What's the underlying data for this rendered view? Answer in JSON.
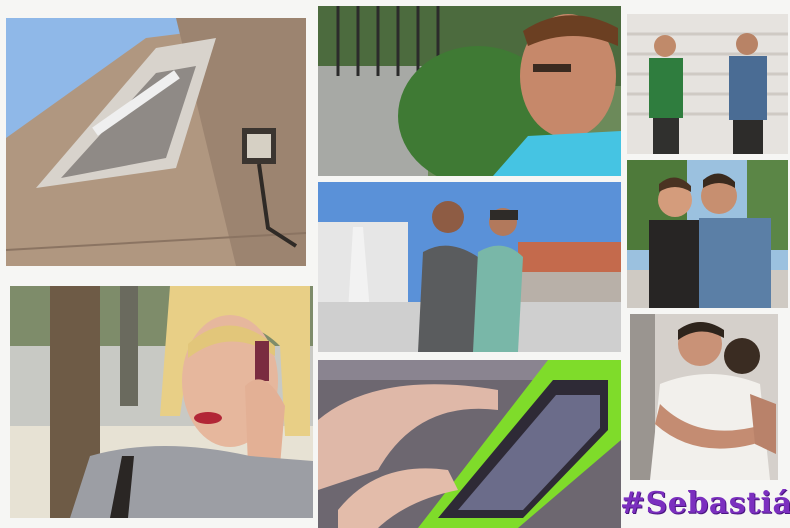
{
  "hashtag": {
    "text": "#Sebastián"
  },
  "colors": {
    "hashtag": "#7b2fbf",
    "sky": "#8fb8e8",
    "building": "#b09780",
    "tablet_case": "#7fdc2a",
    "shirt_cyan": "#4cc6e3",
    "shirt_green": "#2f7d3e",
    "shirt_denim": "#4a6c94"
  }
}
